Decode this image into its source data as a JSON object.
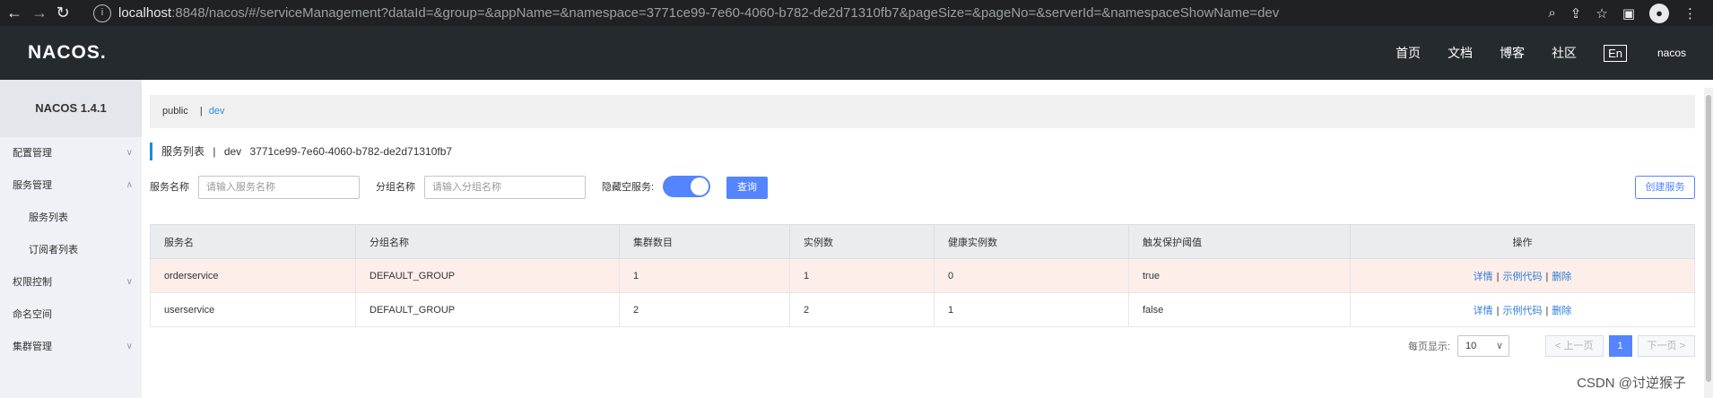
{
  "browser": {
    "back_icon": "arrow-left-icon",
    "forward_icon": "arrow-right-icon",
    "reload_icon": "reload-icon",
    "url_host": "localhost",
    "url_rest": ":8848/nacos/#/serviceManagement?dataId=&group=&appName=&namespace=3771ce99-7e60-4060-b782-de2d71310fb7&pageSize=&pageNo=&serverId=&namespaceShowName=dev"
  },
  "header": {
    "logo": "NACOS.",
    "nav": [
      "首页",
      "文档",
      "博客",
      "社区"
    ],
    "lang": "En",
    "user": "nacos"
  },
  "sidebar": {
    "title": "NACOS 1.4.1",
    "items": [
      {
        "label": "配置管理",
        "chevron": "∨"
      },
      {
        "label": "服务管理",
        "chevron": "∧"
      },
      {
        "label": "服务列表"
      },
      {
        "label": "订阅者列表"
      },
      {
        "label": "权限控制",
        "chevron": "∨"
      },
      {
        "label": "命名空间"
      },
      {
        "label": "集群管理",
        "chevron": "∨"
      }
    ]
  },
  "namespaces": {
    "public": "public",
    "sep": "|",
    "dev": "dev"
  },
  "page": {
    "title": "服务列表",
    "sep": "|",
    "ns_name": "dev",
    "ns_id": "3771ce99-7e60-4060-b782-de2d71310fb7"
  },
  "filter": {
    "service_label": "服务名称",
    "service_placeholder": "请输入服务名称",
    "group_label": "分组名称",
    "group_placeholder": "请输入分组名称",
    "hide_empty_label": "隐藏空服务:",
    "query_button": "查询",
    "create_button": "创建服务"
  },
  "table": {
    "headers": [
      "服务名",
      "分组名称",
      "集群数目",
      "实例数",
      "健康实例数",
      "触发保护阈值",
      "操作"
    ],
    "rows": [
      {
        "name": "orderservice",
        "group": "DEFAULT_GROUP",
        "clusters": "1",
        "instances": "1",
        "healthy": "0",
        "protect": "true"
      },
      {
        "name": "userservice",
        "group": "DEFAULT_GROUP",
        "clusters": "2",
        "instances": "2",
        "healthy": "1",
        "protect": "false"
      }
    ],
    "actions": {
      "detail": "详情",
      "sample": "示例代码",
      "delete": "删除",
      "sep": "|"
    }
  },
  "pager": {
    "per_page_label": "每页显示:",
    "per_page_value": "10",
    "prev": "< 上一页",
    "current_page": "1",
    "next": "下一页 >"
  },
  "watermark": "CSDN @讨逆猴子"
}
